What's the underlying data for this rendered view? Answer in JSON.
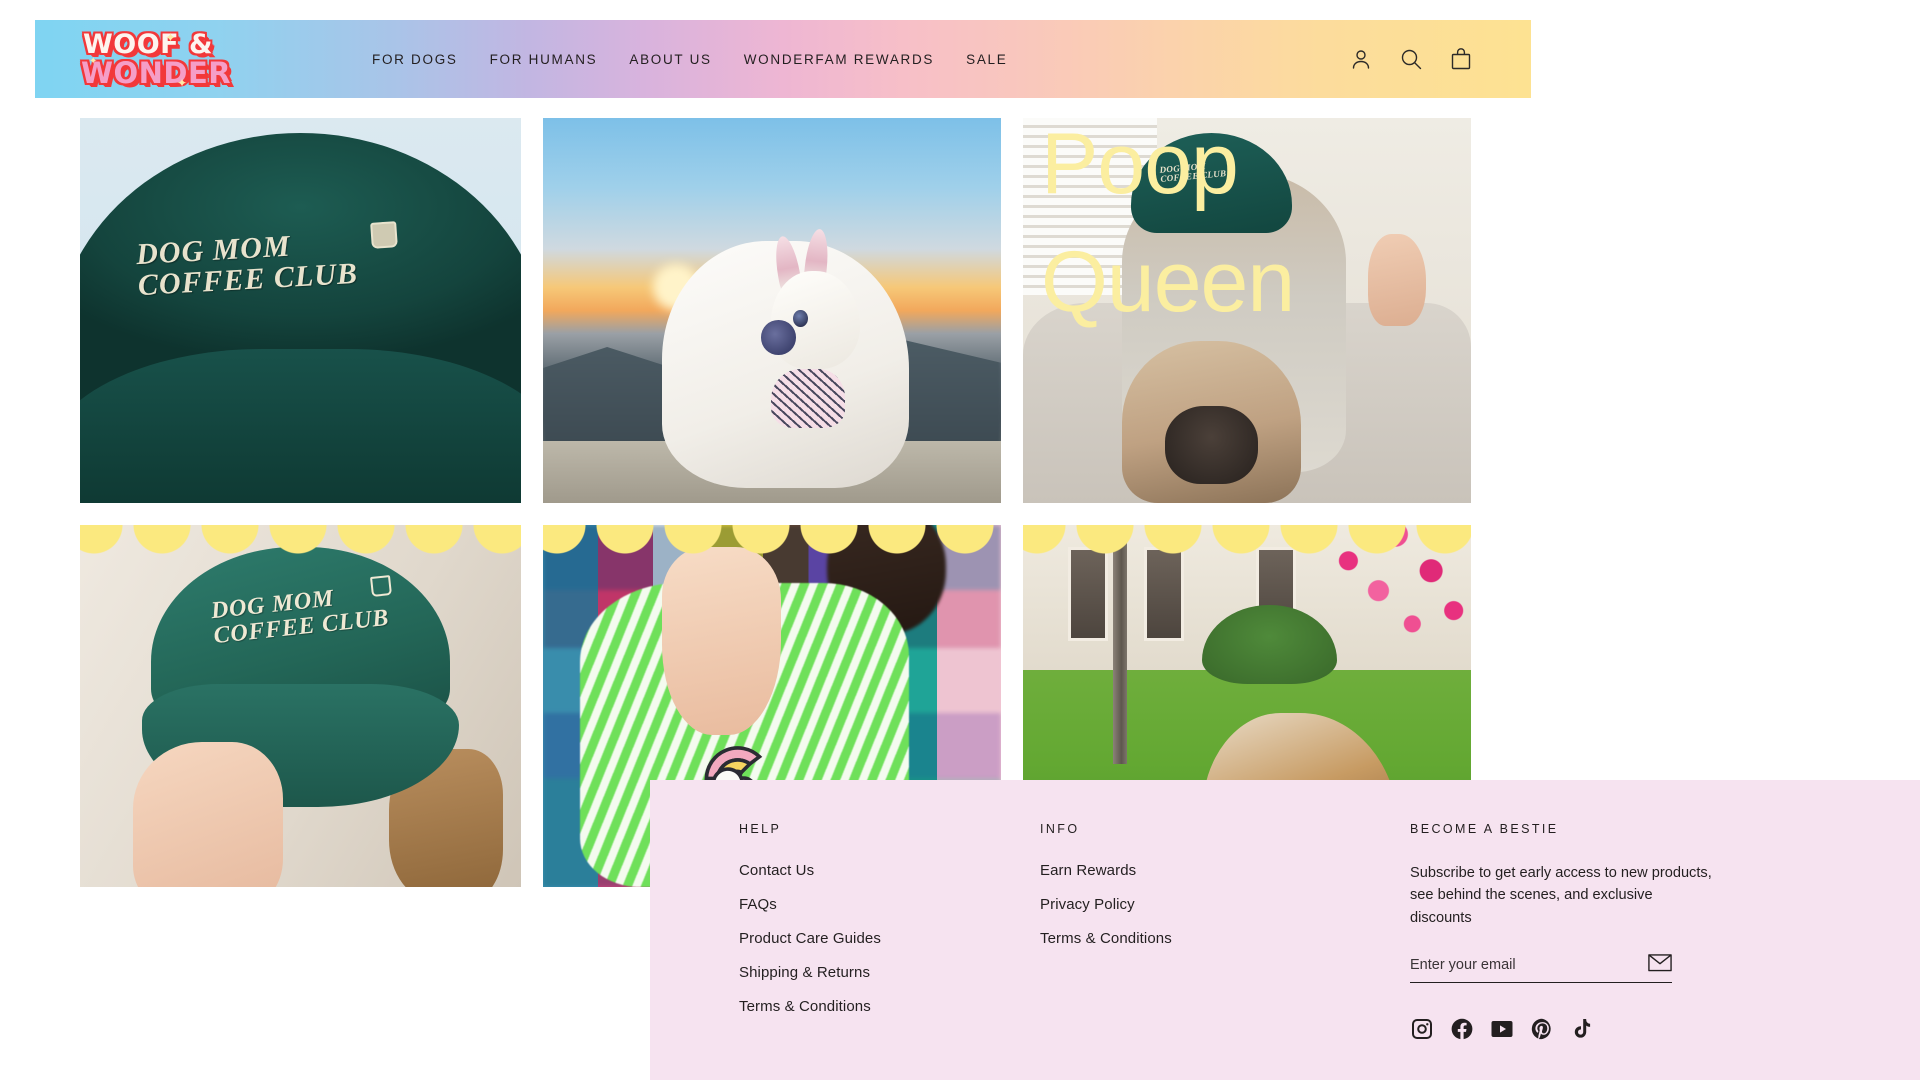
{
  "header": {
    "logo": {
      "line1": "WOOF &",
      "line2": "WONDER",
      "name": "Woof & Wonder"
    },
    "nav": [
      {
        "label": "FOR DOGS",
        "name": "for-dogs"
      },
      {
        "label": "FOR HUMANS",
        "name": "for-humans"
      },
      {
        "label": "ABOUT US",
        "name": "about-us"
      },
      {
        "label": "WONDERFAM REWARDS",
        "name": "wonderfam-rewards"
      },
      {
        "label": "SALE",
        "name": "sale"
      }
    ],
    "icons": [
      {
        "name": "account-icon",
        "label": "Log in"
      },
      {
        "name": "search-icon",
        "label": "Search"
      },
      {
        "name": "cart-icon",
        "label": "Cart"
      }
    ]
  },
  "gallery": {
    "tiles": [
      {
        "name": "product-hat-green-closeup",
        "alt": "Dark green Dog Mom Coffee Club embroidered cap close-up",
        "cap_text": "DOG MOM\nCOFFEE CLUB"
      },
      {
        "name": "lifestyle-frenchie-sunset",
        "alt": "White French bulldog in leopard harness at sunset on a hillside"
      },
      {
        "name": "lifestyle-poop-queen-video",
        "alt": "Woman in green Dog Mom Coffee Club cap holding a fawn French bulldog",
        "overlay_line1": "Poop",
        "overlay_line2": "Queen",
        "cap_text": "DOG MOM\nCOFFEE CLUB"
      },
      {
        "name": "product-hat-green-held",
        "alt": "Woman holding a green Dog Mom Coffee Club cap over her face",
        "cap_text": "DOG MOM\nCOFFEE CLUB"
      },
      {
        "name": "lifestyle-rainbow-sticker",
        "alt": "Hand holding a rainbow cloud sticker in front of a colorful wall"
      },
      {
        "name": "lifestyle-beagle-yard",
        "alt": "Beagle wearing a blue bandana sitting on green grass by pink blossoms"
      }
    ]
  },
  "footer": {
    "help": {
      "title": "HELP",
      "links": [
        "Contact Us",
        "FAQs",
        "Product Care Guides",
        "Shipping & Returns",
        "Terms & Conditions"
      ]
    },
    "info": {
      "title": "INFO",
      "links": [
        "Earn Rewards",
        "Privacy Policy",
        "Terms & Conditions"
      ]
    },
    "newsletter": {
      "title": "BECOME A BESTIE",
      "description": "Subscribe to get early access to new products, see behind the scenes, and exclusive discounts",
      "placeholder": "Enter your email",
      "value": "",
      "submit_icon": "envelope-icon"
    },
    "socials": [
      {
        "name": "instagram-icon",
        "label": "Instagram"
      },
      {
        "name": "facebook-icon",
        "label": "Facebook"
      },
      {
        "name": "youtube-icon",
        "label": "YouTube"
      },
      {
        "name": "pinterest-icon",
        "label": "Pinterest"
      },
      {
        "name": "tiktok-icon",
        "label": "TikTok"
      }
    ]
  },
  "colors": {
    "footer_bg": "#f6e3f0",
    "text": "#231f20",
    "overlay_yellow": "#fbeea0",
    "scallop_yellow": "#fbe97f",
    "logo_red": "#f2383a",
    "logo_pink": "#f59ec7"
  }
}
